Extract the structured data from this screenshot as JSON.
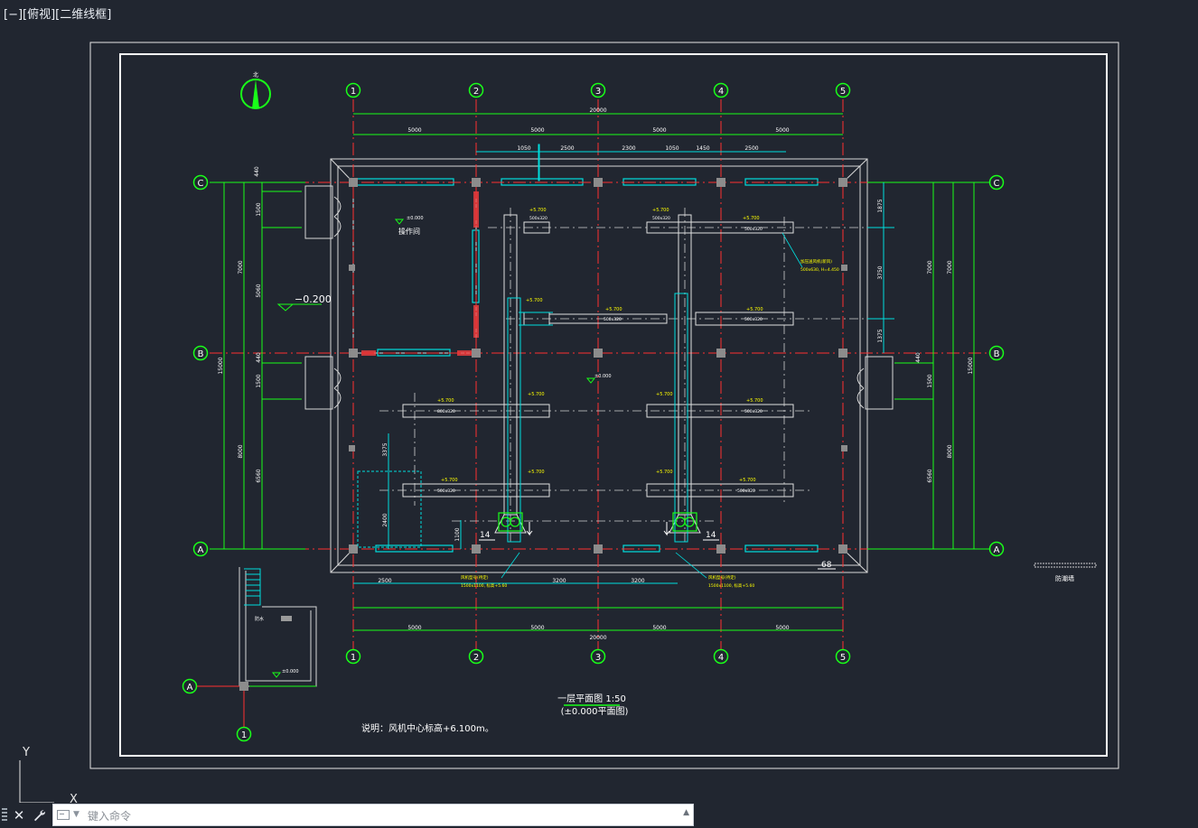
{
  "viewport_label": "[−][俯视][二维线框]",
  "colors": {
    "background": "#212630",
    "frame": "#ffffff",
    "axis_line": "#ff3030",
    "dimension": "#19ff19",
    "duct": "#00dede",
    "wall": "#d8d8d8",
    "label": "#ffffff",
    "accent_text": "#ffff00",
    "hatch": "#ff4040"
  },
  "axis_labels": {
    "columns": [
      "1",
      "2",
      "3",
      "4",
      "5"
    ],
    "rows": [
      "C",
      "B",
      "A"
    ]
  },
  "dimensions": {
    "overall_width": "20000",
    "bay_widths": [
      "5000",
      "5000",
      "5000",
      "5000"
    ],
    "upper_sub": [
      "1050",
      "2500",
      "2300",
      "1050",
      "1450",
      "2500"
    ],
    "lower_sub": [
      "2500",
      "3200",
      "3200"
    ],
    "left_overall": "15000",
    "left_segments": [
      "7000",
      "8000"
    ],
    "left_inner": [
      "440",
      "1500",
      "5060",
      "440",
      "1500",
      "6560"
    ],
    "left_small": [
      "3375",
      "2400",
      "1100"
    ],
    "right_overall": "15000",
    "right_segments": [
      "7000",
      "8000"
    ],
    "right_inner": [
      "1875",
      "3750",
      "1375",
      "440",
      "1500",
      "6560"
    ]
  },
  "room_label": "操作间",
  "level_floor": "±0.000",
  "level_outside": "−0.200",
  "level_center": "±0.000",
  "duct_levels": [
    "+5.700",
    "+5.700",
    "+5.700",
    "+5.700",
    "+5.700",
    "+5.700",
    "+5.700",
    "+5.700"
  ],
  "duct_sizes": [
    "500x320",
    "500x320",
    "500x320",
    "500x320",
    "500x320",
    "800x320",
    "500x320",
    "500x320"
  ],
  "fan_note_right": "加压送风机(新风)",
  "fan_note_right_2": "500x630, H=4.450",
  "fan_note_bottom_left": "风机型号(待定)",
  "fan_note_bottom_left_2": "1500x1100, 标高+5.60",
  "fan_note_bottom_right": "风机型号(待定)",
  "fan_note_bottom_right_2": "1500x1100, 标高+5.60",
  "section_mark_left": "14",
  "section_mark_right": "14",
  "mark_68": "68",
  "legend_label": "防潮墙",
  "detail_label": "防水",
  "detail_level": "±0.000",
  "detail_axis": "A",
  "detail_axis_col": "1",
  "plan_title": "一层平面图 1:50",
  "plan_subtitle": "(±0.000平面图)",
  "note": "说明：风机中心标高+6.100m。",
  "north_mark": "北",
  "ucs_y": "Y",
  "ucs_x": "X",
  "command": {
    "placeholder": "键入命令",
    "close_label": "✕"
  }
}
